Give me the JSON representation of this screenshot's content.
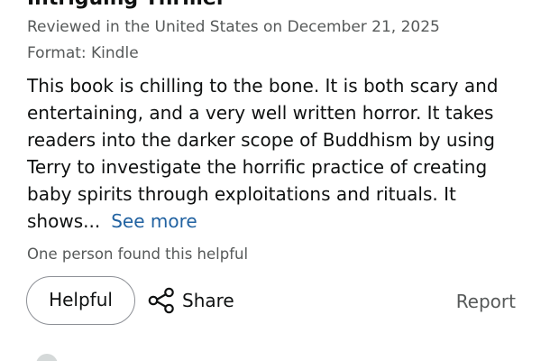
{
  "review": {
    "title": "Intriguing Thriller",
    "reviewed_in": "Reviewed in the United States on December 21, 2025",
    "format": "Format: Kindle",
    "body": "This book is chilling to the bone. It is both scary and entertaining, and a very well written horror. It takes readers into the darker scope of Buddhism by using Terry to investigate the horrific practice of creating baby spirits through exploitations and rituals. It shows...",
    "see_more_label": "See more",
    "helpful_count_text": "One person found this helpful"
  },
  "actions": {
    "helpful_label": "Helpful",
    "share_label": "Share",
    "share_icon": "share-icon",
    "report_label": "Report"
  },
  "colors": {
    "text_primary": "#0f1111",
    "text_secondary": "#565959",
    "link": "#2162a1",
    "button_border": "#8d9096"
  }
}
